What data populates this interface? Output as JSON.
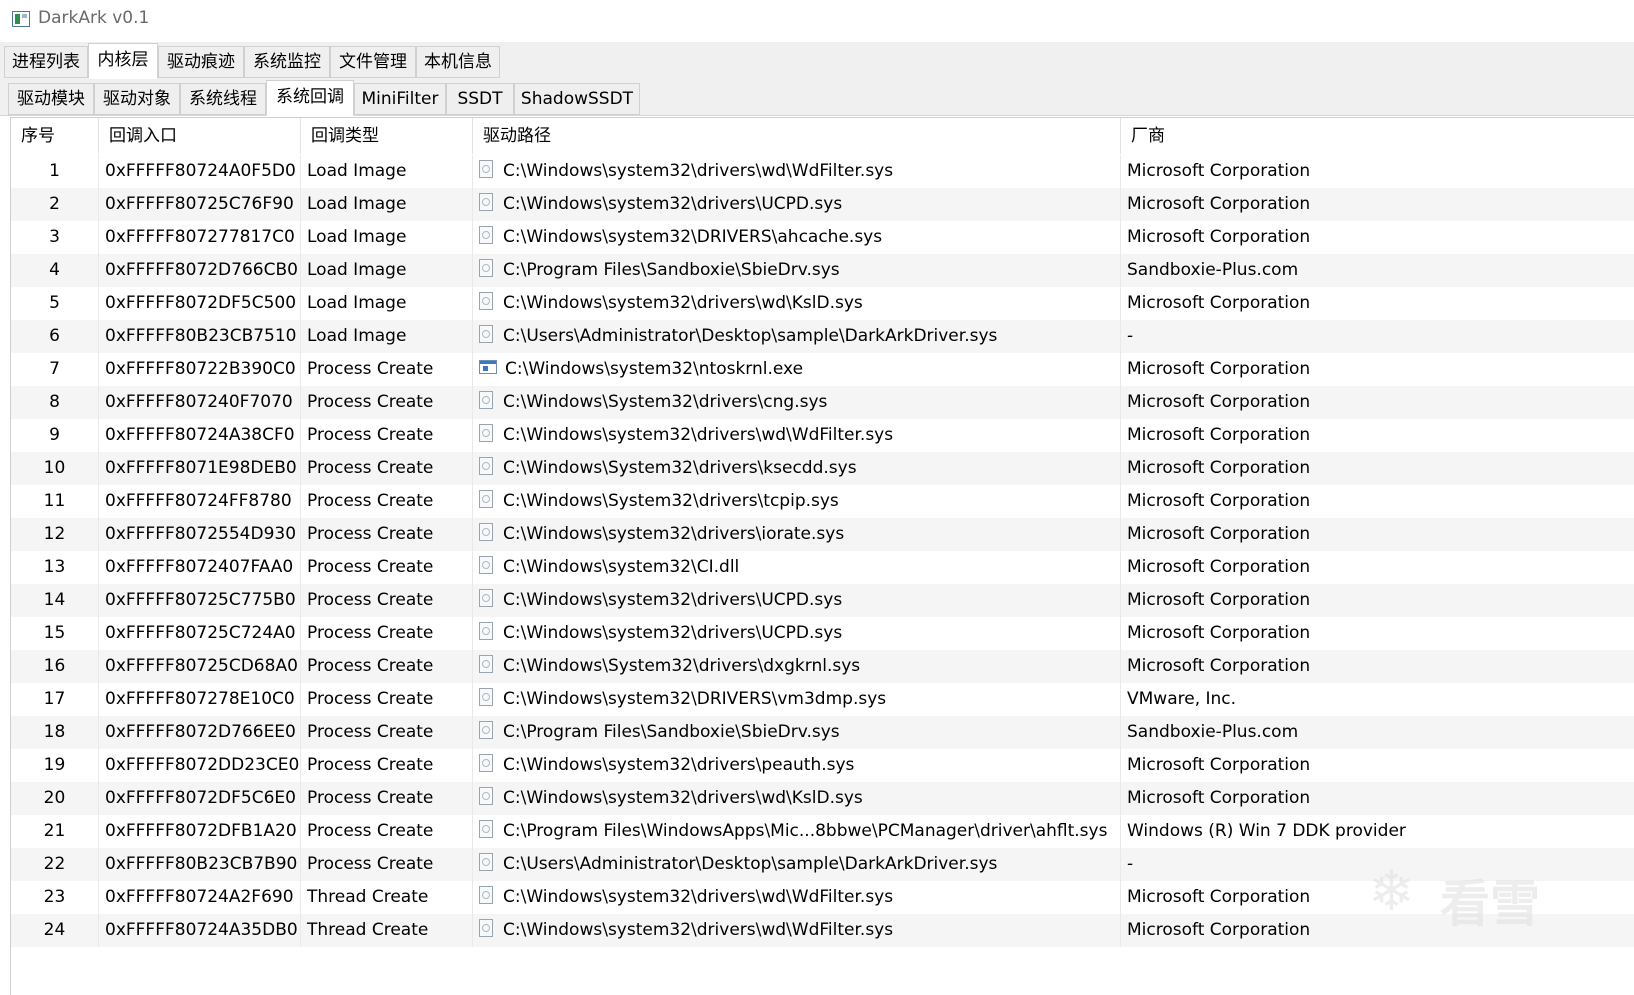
{
  "window": {
    "title": "DarkArk v0.1"
  },
  "main_tabs": [
    {
      "label": "进程列表",
      "active": false
    },
    {
      "label": "内核层",
      "active": true
    },
    {
      "label": "驱动痕迹",
      "active": false
    },
    {
      "label": "系统监控",
      "active": false
    },
    {
      "label": "文件管理",
      "active": false
    },
    {
      "label": "本机信息",
      "active": false
    }
  ],
  "sub_tabs": [
    {
      "label": "驱动模块",
      "active": false
    },
    {
      "label": "驱动对象",
      "active": false
    },
    {
      "label": "系统线程",
      "active": false
    },
    {
      "label": "系统回调",
      "active": true
    },
    {
      "label": "MiniFilter",
      "active": false
    },
    {
      "label": "SSDT",
      "active": false
    },
    {
      "label": "ShadowSSDT",
      "active": false
    }
  ],
  "table": {
    "columns": [
      "序号",
      "回调入口",
      "回调类型",
      "驱动路径",
      "厂商"
    ],
    "rows": [
      {
        "index": "1",
        "entry": "0xFFFFF80724A0F5D0",
        "type": "Load Image",
        "path": "C:\\Windows\\system32\\drivers\\wd\\WdFilter.sys",
        "icon": "file-icon",
        "vendor": "Microsoft Corporation"
      },
      {
        "index": "2",
        "entry": "0xFFFFF80725C76F90",
        "type": "Load Image",
        "path": "C:\\Windows\\system32\\drivers\\UCPD.sys",
        "icon": "file-icon",
        "vendor": "Microsoft Corporation"
      },
      {
        "index": "3",
        "entry": "0xFFFFF807277817C0",
        "type": "Load Image",
        "path": "C:\\Windows\\system32\\DRIVERS\\ahcache.sys",
        "icon": "file-icon",
        "vendor": "Microsoft Corporation"
      },
      {
        "index": "4",
        "entry": "0xFFFFF8072D766CB0",
        "type": "Load Image",
        "path": "C:\\Program Files\\Sandboxie\\SbieDrv.sys",
        "icon": "file-icon",
        "vendor": "Sandboxie-Plus.com"
      },
      {
        "index": "5",
        "entry": "0xFFFFF8072DF5C500",
        "type": "Load Image",
        "path": "C:\\Windows\\system32\\drivers\\wd\\KslD.sys",
        "icon": "file-icon",
        "vendor": "Microsoft Corporation"
      },
      {
        "index": "6",
        "entry": "0xFFFFF80B23CB7510",
        "type": "Load Image",
        "path": "C:\\Users\\Administrator\\Desktop\\sample\\DarkArkDriver.sys",
        "icon": "file-icon",
        "vendor": "-"
      },
      {
        "index": "7",
        "entry": "0xFFFFF80722B390C0",
        "type": "Process Create",
        "path": "C:\\Windows\\system32\\ntoskrnl.exe",
        "icon": "exe-icon",
        "vendor": "Microsoft Corporation"
      },
      {
        "index": "8",
        "entry": "0xFFFFF807240F7070",
        "type": "Process Create",
        "path": "C:\\Windows\\System32\\drivers\\cng.sys",
        "icon": "file-icon",
        "vendor": "Microsoft Corporation"
      },
      {
        "index": "9",
        "entry": "0xFFFFF80724A38CF0",
        "type": "Process Create",
        "path": "C:\\Windows\\system32\\drivers\\wd\\WdFilter.sys",
        "icon": "file-icon",
        "vendor": "Microsoft Corporation"
      },
      {
        "index": "10",
        "entry": "0xFFFFF8071E98DEB0",
        "type": "Process Create",
        "path": "C:\\Windows\\System32\\drivers\\ksecdd.sys",
        "icon": "file-icon",
        "vendor": "Microsoft Corporation"
      },
      {
        "index": "11",
        "entry": "0xFFFFF80724FF8780",
        "type": "Process Create",
        "path": "C:\\Windows\\System32\\drivers\\tcpip.sys",
        "icon": "file-icon",
        "vendor": "Microsoft Corporation"
      },
      {
        "index": "12",
        "entry": "0xFFFFF8072554D930",
        "type": "Process Create",
        "path": "C:\\Windows\\system32\\drivers\\iorate.sys",
        "icon": "file-icon",
        "vendor": "Microsoft Corporation"
      },
      {
        "index": "13",
        "entry": "0xFFFFF8072407FAA0",
        "type": "Process Create",
        "path": "C:\\Windows\\system32\\CI.dll",
        "icon": "file-icon",
        "vendor": "Microsoft Corporation"
      },
      {
        "index": "14",
        "entry": "0xFFFFF80725C775B0",
        "type": "Process Create",
        "path": "C:\\Windows\\system32\\drivers\\UCPD.sys",
        "icon": "file-icon",
        "vendor": "Microsoft Corporation"
      },
      {
        "index": "15",
        "entry": "0xFFFFF80725C724A0",
        "type": "Process Create",
        "path": "C:\\Windows\\system32\\drivers\\UCPD.sys",
        "icon": "file-icon",
        "vendor": "Microsoft Corporation"
      },
      {
        "index": "16",
        "entry": "0xFFFFF80725CD68A0",
        "type": "Process Create",
        "path": "C:\\Windows\\System32\\drivers\\dxgkrnl.sys",
        "icon": "file-icon",
        "vendor": "Microsoft Corporation"
      },
      {
        "index": "17",
        "entry": "0xFFFFF807278E10C0",
        "type": "Process Create",
        "path": "C:\\Windows\\system32\\DRIVERS\\vm3dmp.sys",
        "icon": "file-icon",
        "vendor": "VMware, Inc."
      },
      {
        "index": "18",
        "entry": "0xFFFFF8072D766EE0",
        "type": "Process Create",
        "path": "C:\\Program Files\\Sandboxie\\SbieDrv.sys",
        "icon": "file-icon",
        "vendor": "Sandboxie-Plus.com"
      },
      {
        "index": "19",
        "entry": "0xFFFFF8072DD23CE0",
        "type": "Process Create",
        "path": "C:\\Windows\\system32\\drivers\\peauth.sys",
        "icon": "file-icon",
        "vendor": "Microsoft Corporation"
      },
      {
        "index": "20",
        "entry": "0xFFFFF8072DF5C6E0",
        "type": "Process Create",
        "path": "C:\\Windows\\system32\\drivers\\wd\\KslD.sys",
        "icon": "file-icon",
        "vendor": "Microsoft Corporation"
      },
      {
        "index": "21",
        "entry": "0xFFFFF8072DFB1A20",
        "type": "Process Create",
        "path": "C:\\Program Files\\WindowsApps\\Mic...8bbwe\\PCManager\\driver\\ahflt.sys",
        "icon": "file-icon",
        "vendor": "Windows (R) Win 7 DDK provider"
      },
      {
        "index": "22",
        "entry": "0xFFFFF80B23CB7B90",
        "type": "Process Create",
        "path": "C:\\Users\\Administrator\\Desktop\\sample\\DarkArkDriver.sys",
        "icon": "file-icon",
        "vendor": "-"
      },
      {
        "index": "23",
        "entry": "0xFFFFF80724A2F690",
        "type": "Thread Create",
        "path": "C:\\Windows\\system32\\drivers\\wd\\WdFilter.sys",
        "icon": "file-icon",
        "vendor": "Microsoft Corporation"
      },
      {
        "index": "24",
        "entry": "0xFFFFF80724A35DB0",
        "type": "Thread Create",
        "path": "C:\\Windows\\system32\\drivers\\wd\\WdFilter.sys",
        "icon": "file-icon",
        "vendor": "Microsoft Corporation"
      }
    ]
  },
  "watermark": {
    "text": "看雪",
    "icon": "snowflake-icon"
  },
  "colors": {
    "row_alt": "#f5f5f5",
    "tab_bg": "#f0f0f0",
    "title_text": "#6a6a6a"
  }
}
